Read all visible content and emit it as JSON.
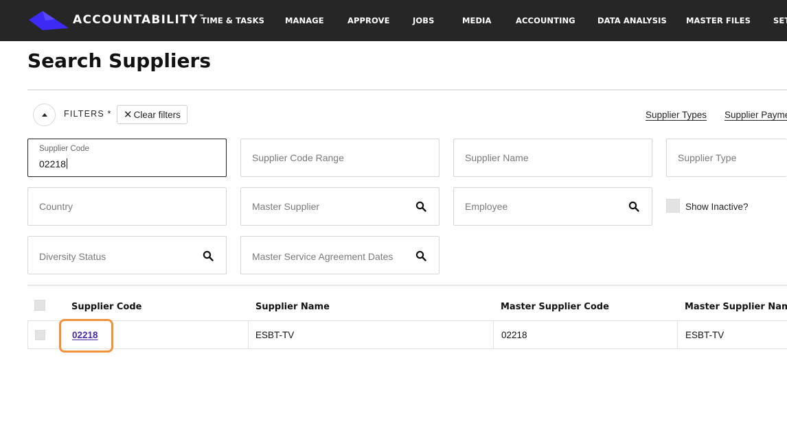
{
  "app": {
    "brand": "ACCOUNTABILITY",
    "trademark": "™",
    "brand_color": "#3d2bf5",
    "nav": [
      {
        "label": "TIME & TASKS"
      },
      {
        "label": "MANAGE"
      },
      {
        "label": "APPROVE"
      },
      {
        "label": "JOBS"
      },
      {
        "label": "MEDIA"
      },
      {
        "label": "ACCOUNTING"
      },
      {
        "label": "DATA ANALYSIS"
      },
      {
        "label": "MASTER FILES"
      },
      {
        "label": "SETTINGS"
      }
    ]
  },
  "page": {
    "title": "Search Suppliers"
  },
  "filters": {
    "label": "FILTERS *",
    "clear_label": "Clear filters",
    "quick_links": [
      "Supplier Types",
      "Supplier Payment"
    ],
    "fields": {
      "supplier_code": {
        "label": "Supplier Code",
        "value": "02218"
      },
      "supplier_code_range": {
        "placeholder": "Supplier Code Range"
      },
      "supplier_name": {
        "placeholder": "Supplier Name"
      },
      "supplier_type": {
        "placeholder": "Supplier Type"
      },
      "country": {
        "placeholder": "Country"
      },
      "master_supplier": {
        "placeholder": "Master Supplier",
        "icon": "search-icon"
      },
      "employee": {
        "placeholder": "Employee",
        "icon": "search-icon"
      },
      "show_inactive": {
        "label": "Show Inactive?",
        "checked": false
      },
      "diversity_status": {
        "placeholder": "Diversity Status",
        "icon": "search-icon"
      },
      "msa_dates": {
        "placeholder": "Master Service Agreement Dates",
        "icon": "search-icon"
      }
    }
  },
  "table": {
    "columns": [
      "Supplier Code",
      "Supplier Name",
      "Master Supplier Code",
      "Master Supplier Name"
    ],
    "rows": [
      {
        "supplier_code": "02218",
        "supplier_name": "ESBT-TV",
        "master_supplier_code": "02218",
        "master_supplier_name": "ESBT-TV"
      }
    ],
    "highlight_color": "#f0913c",
    "link_color": "#4b2aa8"
  }
}
